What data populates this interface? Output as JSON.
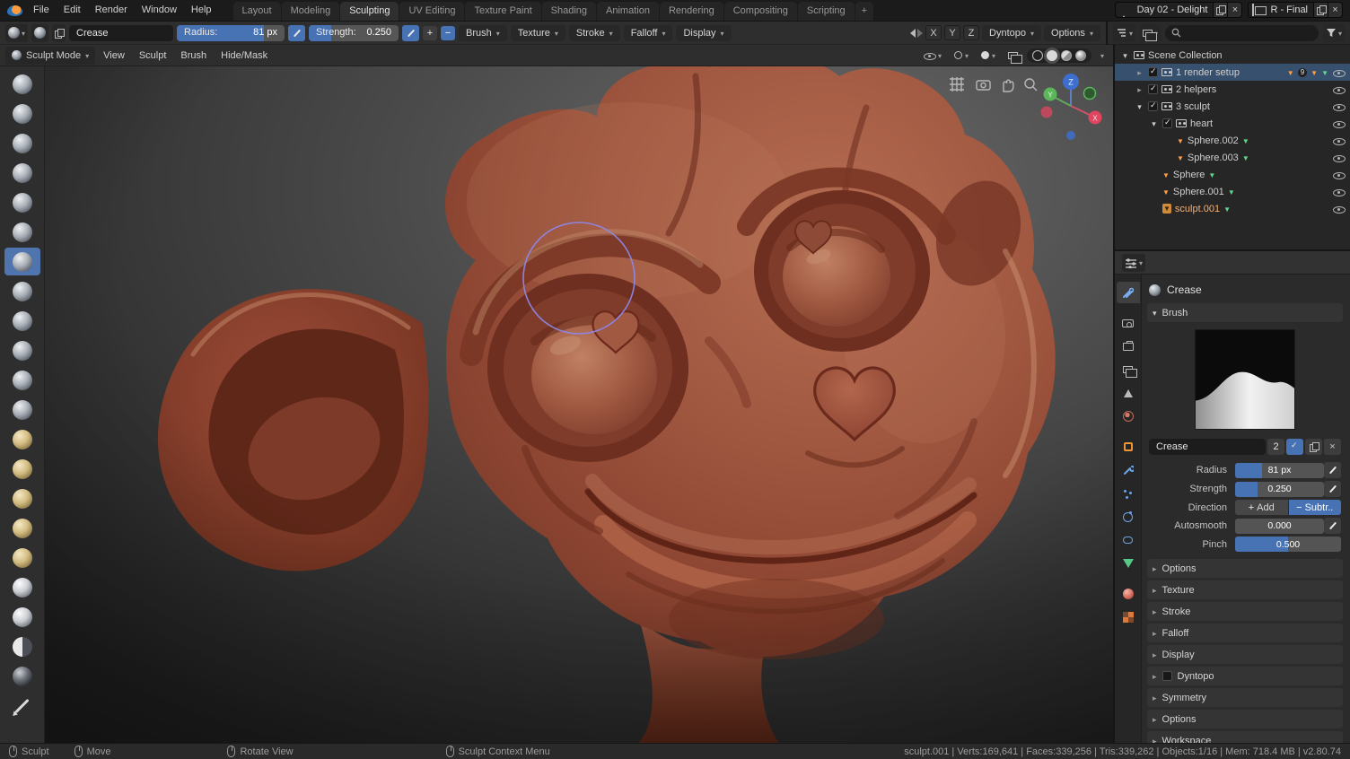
{
  "colors": {
    "accent_blue": "#4772b3",
    "selection_row": "#37506e",
    "active_object_text": "#ffaf66",
    "clay_base": "#9d4f3c"
  },
  "topbar": {
    "menus": [
      "File",
      "Edit",
      "Render",
      "Window",
      "Help"
    ],
    "tabs": [
      "Layout",
      "Modeling",
      "Sculpting",
      "UV Editing",
      "Texture Paint",
      "Shading",
      "Animation",
      "Rendering",
      "Compositing",
      "Scripting"
    ],
    "active_tab": "Sculpting",
    "new_workspace_button": "+",
    "scene_name": "Day 02 - Delight",
    "view_layer_name": "R - Final"
  },
  "tool_settings": {
    "brush_name": "Crease",
    "radius_label": "Radius:",
    "radius_value": "81 px",
    "radius_fill": 0.81,
    "strength_label": "Strength:",
    "strength_value": "0.250",
    "strength_fill": 0.25,
    "add_button": "+",
    "subtract_button": "−",
    "dropdowns": [
      "Brush",
      "Texture",
      "Stroke",
      "Falloff",
      "Display"
    ],
    "mirror_axes": [
      "X",
      "Y",
      "Z"
    ],
    "dyntopo": "Dyntopo",
    "options": "Options"
  },
  "viewport": {
    "mode": "Sculpt Mode",
    "menus": [
      "View",
      "Sculpt",
      "Brush",
      "Hide/Mask"
    ],
    "gizmo_axes": {
      "x": "X",
      "y": "Y",
      "z": "Z"
    }
  },
  "toolbar": {
    "brushes": [
      "Draw",
      "Clay",
      "Clay Strips",
      "Layer",
      "Inflate",
      "Blob",
      "Crease",
      "Smooth",
      "Flatten",
      "Fill",
      "Scrape",
      "Pinch",
      "Grab",
      "Elastic Deform",
      "Snake Hook",
      "Thumb",
      "Pose",
      "Nudge",
      "Rotate",
      "Slide Relax",
      "Mask",
      "Annotate"
    ],
    "active_brush": "Crease"
  },
  "outliner": {
    "root_label": "Scene Collection",
    "items": [
      {
        "label": "1 render setup",
        "badge": "9"
      },
      {
        "label": "2 helpers"
      },
      {
        "label": "3 sculpt"
      },
      {
        "label": "heart"
      },
      {
        "label": "Sphere.002"
      },
      {
        "label": "Sphere.003"
      },
      {
        "label": "Sphere"
      },
      {
        "label": "Sphere.001"
      },
      {
        "label": "sculpt.001"
      }
    ]
  },
  "properties": {
    "active_tool_label": "Crease",
    "brush_panel": "Brush",
    "brush_name_field": "Crease",
    "users_count": "2",
    "radius": {
      "label": "Radius",
      "value": "81 px",
      "fill": 0.3
    },
    "strength": {
      "label": "Strength",
      "value": "0.250",
      "fill": 0.25
    },
    "direction": {
      "label": "Direction",
      "add": "Add",
      "subtract": "Subtr.."
    },
    "autosmooth": {
      "label": "Autosmooth",
      "value": "0.000",
      "fill": 0
    },
    "pinch": {
      "label": "Pinch",
      "value": "0.500",
      "fill": 0.5
    },
    "panels": [
      "Options",
      "Texture",
      "Stroke",
      "Falloff",
      "Display",
      "Dyntopo",
      "Symmetry",
      "Options",
      "Workspace"
    ]
  },
  "statusbar": {
    "hints": [
      "Sculpt",
      "Move",
      "Rotate View",
      "Sculpt Context Menu"
    ],
    "stats": "sculpt.001 | Verts:169,641 | Faces:339,256 | Tris:339,262 | Objects:1/16 | Mem: 718.4 MB | v2.80.74"
  }
}
